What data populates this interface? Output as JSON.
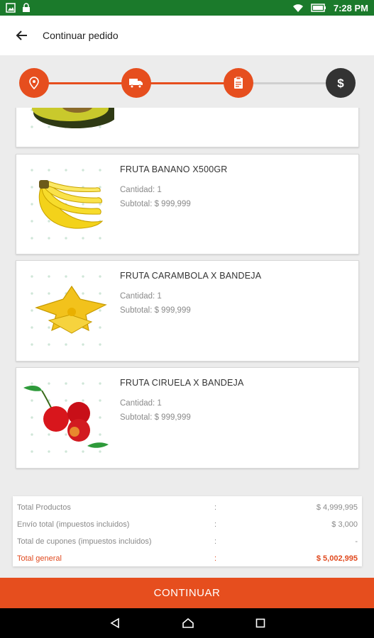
{
  "status_bar": {
    "time": "7:28 PM"
  },
  "app_bar": {
    "title": "Continuar pedido"
  },
  "stepper": {
    "steps": [
      {
        "icon": "location-pin-icon",
        "state": "done"
      },
      {
        "icon": "delivery-truck-icon",
        "state": "done"
      },
      {
        "icon": "clipboard-icon",
        "state": "done"
      },
      {
        "icon": "dollar-icon",
        "state": "current"
      }
    ],
    "active_color": "#e64e1e",
    "pending_color": "#333333"
  },
  "products": [
    {
      "name": "FRUTA BANANO X500GR",
      "quantity": "Cantidad: 1",
      "subtotal": "Subtotal: $ 999,999",
      "image": "banana-image"
    },
    {
      "name": "FRUTA CARAMBOLA X BANDEJA",
      "quantity": "Cantidad: 1",
      "subtotal": "Subtotal: $ 999,999",
      "image": "starfruit-image"
    },
    {
      "name": "FRUTA CIRUELA X BANDEJA",
      "quantity": "Cantidad: 1",
      "subtotal": "Subtotal: $ 999,999",
      "image": "plum-image"
    }
  ],
  "totals": {
    "separator": ":",
    "rows": [
      {
        "label": "Total Productos",
        "value": "$ 4,999,995"
      },
      {
        "label": "Envío total (impuestos incluidos)",
        "value": "$ 3,000"
      },
      {
        "label": "Total de cupones (impuestos incluidos)",
        "value": "-"
      },
      {
        "label": "Total general",
        "value": "$ 5,002,995"
      }
    ]
  },
  "continue_button": {
    "label": "CONTINUAR"
  },
  "colors": {
    "accent": "#e64e1e",
    "status_bar": "#1b7a2b"
  }
}
